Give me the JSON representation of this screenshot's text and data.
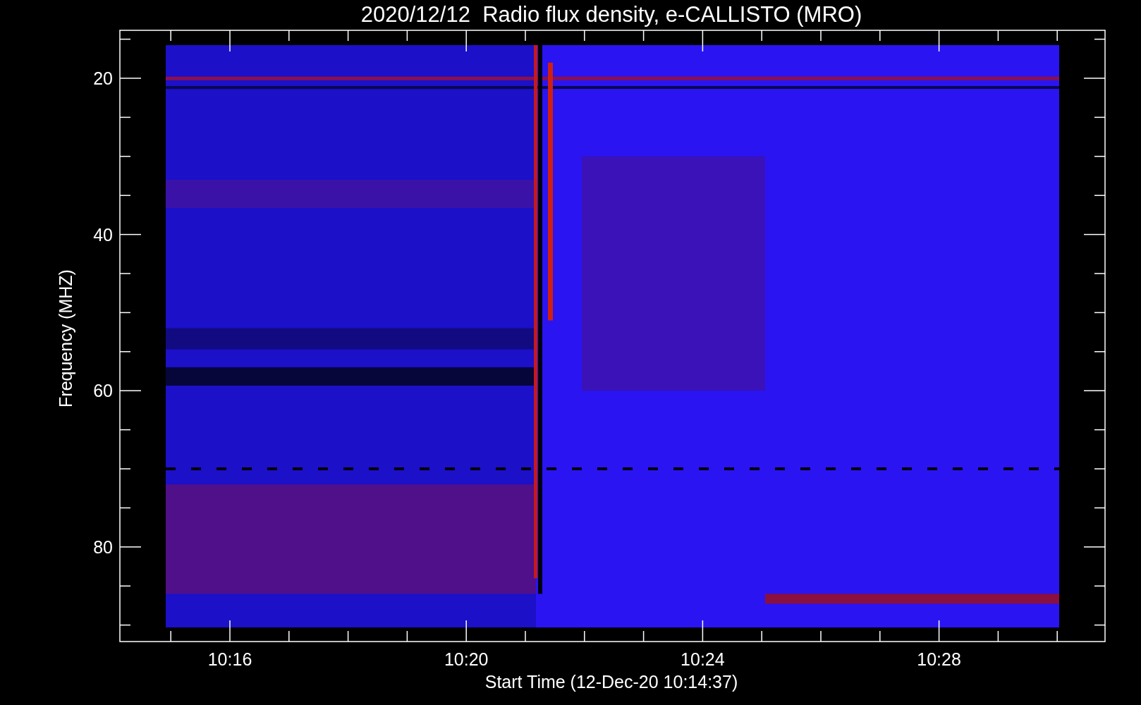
{
  "chart": {
    "title": "2020/12/12  Radio flux density, e-CALLISTO (MRO)",
    "xlabel": "Start Time (12-Dec-20 10:14:37)",
    "ylabel": "Frequency (MHZ)",
    "yticks": [
      "20",
      "40",
      "60",
      "80"
    ],
    "xticks": [
      "10:16",
      "10:20",
      "10:24",
      "10:28"
    ]
  }
}
